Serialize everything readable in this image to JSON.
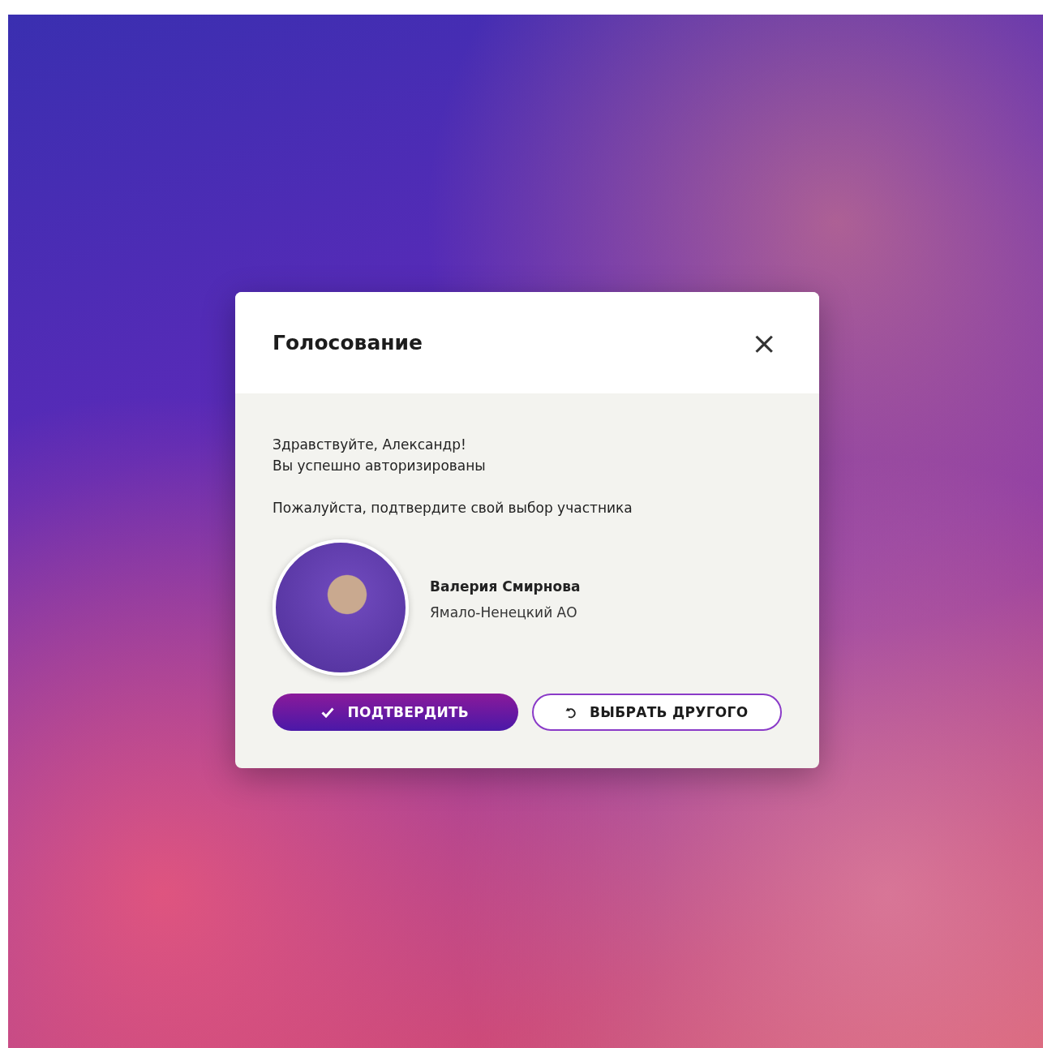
{
  "dialog": {
    "title": "Голосование",
    "close_label": "×",
    "messages": [
      "Здравствуйте, Александр!",
      "Вы успешно авторизированы",
      "Пожалуйста, подтвердите свой выбор участника"
    ],
    "participant": {
      "name": "Валерия Смирнова",
      "region": "Ямало-Ненецкий АО"
    },
    "buttons": [
      {
        "kind": "confirm",
        "label": "ПОДТВЕРДИТЬ"
      },
      {
        "kind": "change",
        "label": "ВЫБРАТЬ ДРУГОГО"
      }
    ]
  }
}
